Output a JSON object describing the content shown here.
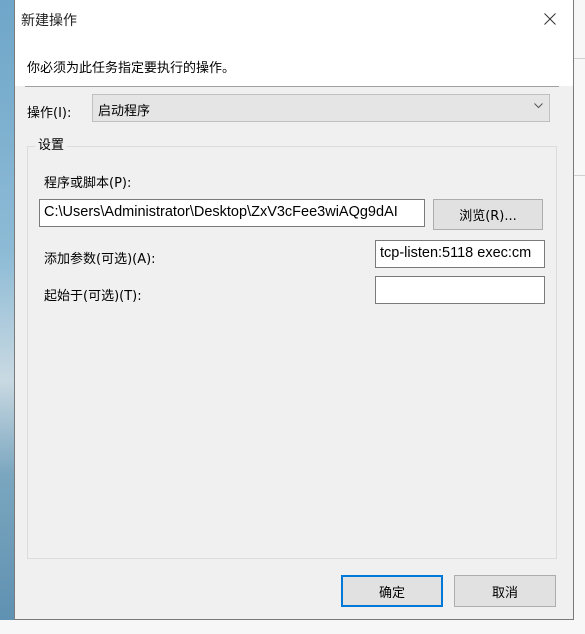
{
  "dialog": {
    "title": "新建操作",
    "prompt": "你必须为此任务指定要执行的操作。",
    "action": {
      "label": "操作(I):",
      "selected": "启动程序"
    },
    "settings": {
      "legend": "设置",
      "program_label": "程序或脚本(P):",
      "program_value": "C:\\Users\\Administrator\\Desktop\\ZxV3cFee3wiAQg9dAI",
      "browse_label": "浏览(R)...",
      "args_label": "添加参数(可选)(A):",
      "args_value": "tcp-listen:5118 exec:cm",
      "start_label": "起始于(可选)(T):",
      "start_value": ""
    },
    "ok_label": "确定",
    "cancel_label": "取消"
  },
  "icons": {
    "close": "close-icon",
    "dropdown": "chevron-down-icon"
  }
}
